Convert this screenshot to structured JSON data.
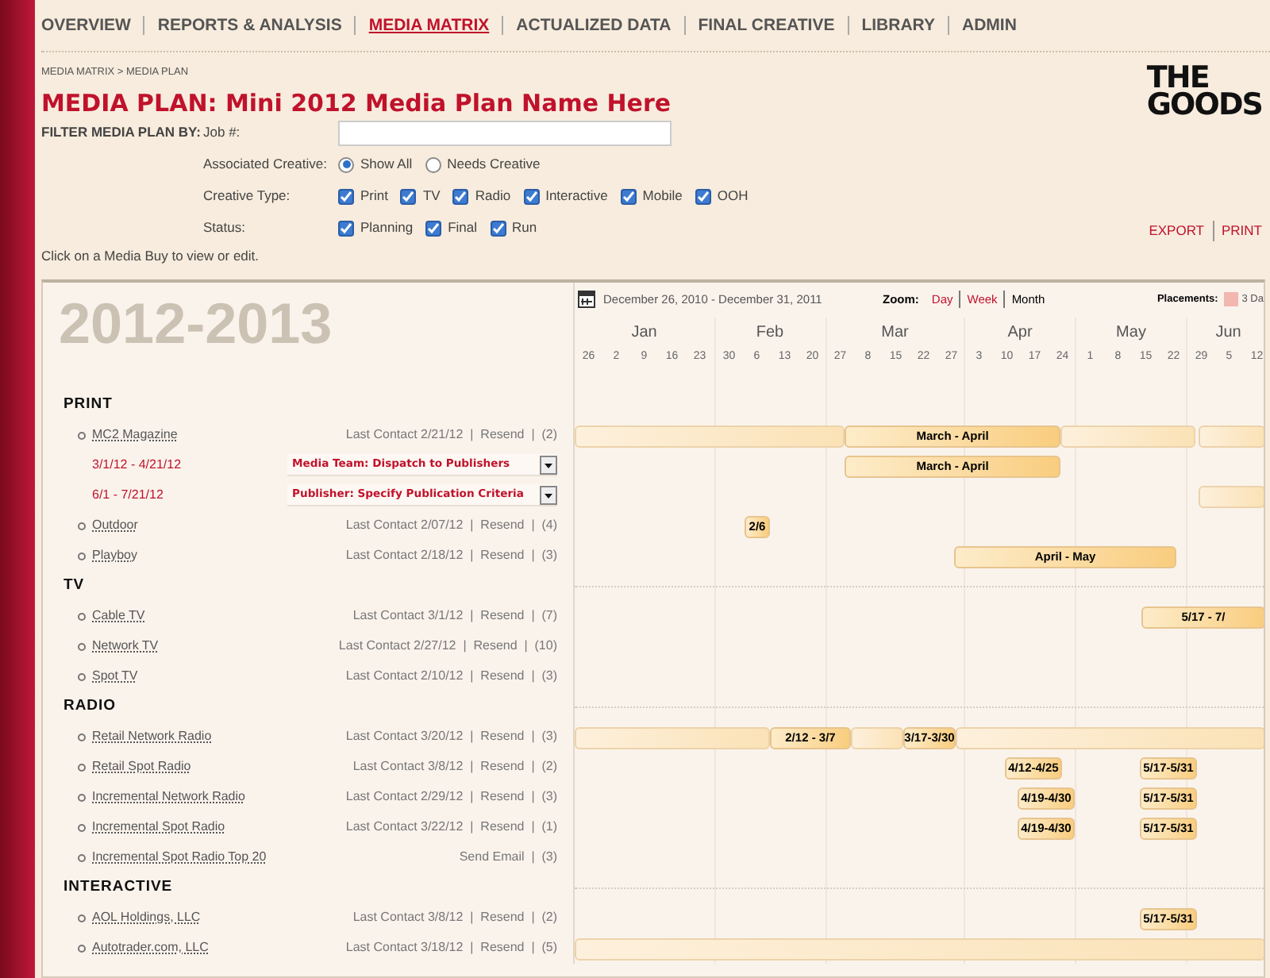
{
  "nav": [
    {
      "label": "OVERVIEW",
      "selected": false
    },
    {
      "label": "REPORTS & ANALYSIS",
      "selected": false
    },
    {
      "label": "MEDIA MATRIX",
      "selected": true
    },
    {
      "label": "ACTUALIZED DATA",
      "selected": false
    },
    {
      "label": "FINAL CREATIVE",
      "selected": false
    },
    {
      "label": "LIBRARY",
      "selected": false
    },
    {
      "label": "ADMIN",
      "selected": false
    }
  ],
  "breadcrumb": "MEDIA MATRIX > MEDIA PLAN",
  "title": "MEDIA PLAN: Mini 2012 Media Plan Name Here",
  "logo": [
    "THE",
    "GOODS"
  ],
  "filter": {
    "heading": "FILTER MEDIA PLAN BY:",
    "job": {
      "label": "Job #:"
    },
    "associated": {
      "label": "Associated Creative:",
      "options": [
        {
          "label": "Show All",
          "selected": true
        },
        {
          "label": "Needs Creative",
          "selected": false
        }
      ]
    },
    "creative_type": {
      "label": "Creative Type:",
      "options": [
        {
          "label": "Print",
          "checked": true
        },
        {
          "label": "TV",
          "checked": true
        },
        {
          "label": "Radio",
          "checked": true
        },
        {
          "label": "Interactive",
          "checked": true
        },
        {
          "label": "Mobile",
          "checked": true
        },
        {
          "label": "OOH",
          "checked": true
        }
      ]
    },
    "status": {
      "label": "Status:",
      "options": [
        {
          "label": "Planning",
          "checked": true
        },
        {
          "label": "Final",
          "checked": true
        },
        {
          "label": "Run",
          "checked": true
        }
      ]
    }
  },
  "actions": [
    "EXPORT",
    "PRINT"
  ],
  "hint": "Click on a Media Buy to view or edit.",
  "panel": {
    "year": "2012-2013",
    "date_range": "December 26, 2010 - December 31, 2011",
    "zoom": {
      "label": "Zoom:",
      "options": [
        {
          "label": "Day",
          "selected": false
        },
        {
          "label": "Week",
          "selected": false
        },
        {
          "label": "Month",
          "selected": true
        }
      ]
    },
    "placements": {
      "label": "Placements:",
      "legend": "3 Da",
      "color": "#f2b8b0"
    },
    "months": [
      {
        "name": "Jan",
        "weeks": [
          "26",
          "2",
          "9",
          "16",
          "23"
        ]
      },
      {
        "name": "Feb",
        "weeks": [
          "30",
          "6",
          "13",
          "20"
        ]
      },
      {
        "name": "Mar",
        "weeks": [
          "27",
          "8",
          "15",
          "22",
          "27"
        ]
      },
      {
        "name": "Apr",
        "weeks": [
          "3",
          "10",
          "17",
          "24"
        ]
      },
      {
        "name": "May",
        "weeks": [
          "1",
          "8",
          "15",
          "22"
        ]
      },
      {
        "name": "Jun",
        "weeks": [
          "29",
          "5",
          "12"
        ]
      }
    ],
    "sections": [
      {
        "title": "PRINT",
        "items": [
          {
            "kind": "media",
            "name": "MC2 Magazine",
            "meta": "Last Contact 2/21/12  |  Resend  |  (2)",
            "bars": [
              {
                "kind": "base"
              },
              {
                "kind": "segment",
                "label": "March - April"
              },
              {
                "kind": "base"
              },
              {
                "kind": "base"
              }
            ]
          },
          {
            "kind": "flight",
            "dates": "3/1/12 - 4/21/12",
            "status": "Media Team: Dispatch to Publishers",
            "bars": [
              {
                "kind": "segment",
                "label": "March - April"
              }
            ]
          },
          {
            "kind": "flight",
            "dates": "6/1 - 7/21/12",
            "status": "Publisher: Specify Publication Criteria",
            "bars": [
              {
                "kind": "base"
              }
            ]
          },
          {
            "kind": "media",
            "name": "Outdoor",
            "meta": "Last Contact 2/07/12  |  Resend  |  (4)",
            "bars": [
              {
                "kind": "segment",
                "label": "2/6"
              }
            ]
          },
          {
            "kind": "media",
            "name": "Playboy",
            "meta": "Last Contact 2/18/12  |  Resend  |  (3)",
            "bars": [
              {
                "kind": "segment",
                "label": "April - May"
              }
            ]
          }
        ]
      },
      {
        "title": "TV",
        "items": [
          {
            "kind": "media",
            "name": "Cable TV",
            "meta": "Last Contact 3/1/12  |  Resend  |  (7)",
            "bars": [
              {
                "kind": "segment",
                "label": "5/17 - 7/"
              }
            ]
          },
          {
            "kind": "media",
            "name": "Network TV",
            "meta": "Last Contact 2/27/12  |  Resend  |  (10)"
          },
          {
            "kind": "media",
            "name": "Spot TV",
            "meta": "Last Contact 2/10/12  |  Resend  |  (3)"
          }
        ]
      },
      {
        "title": "RADIO",
        "items": [
          {
            "kind": "media",
            "name": "Retail Network Radio",
            "meta": "Last Contact 3/20/12  |  Resend  |  (3)",
            "bars": [
              {
                "kind": "base"
              },
              {
                "kind": "segment",
                "label": "2/12 - 3/7"
              },
              {
                "kind": "base"
              },
              {
                "kind": "segment",
                "label": "3/17-3/30"
              },
              {
                "kind": "base"
              }
            ]
          },
          {
            "kind": "media",
            "name": "Retail Spot Radio",
            "meta": "Last Contact 3/8/12  |  Resend  |  (2)",
            "bars": [
              {
                "kind": "segment",
                "label": "4/12-4/25"
              },
              {
                "kind": "segment",
                "label": "5/17-5/31"
              }
            ]
          },
          {
            "kind": "media",
            "name": "Incremental Network Radio",
            "meta": "Last Contact 2/29/12  |  Resend  |  (3)",
            "bars": [
              {
                "kind": "segment",
                "label": "4/19-4/30"
              },
              {
                "kind": "segment",
                "label": "5/17-5/31"
              }
            ]
          },
          {
            "kind": "media",
            "name": "Incremental Spot Radio",
            "meta": "Last Contact 3/22/12  |  Resend  |  (1)",
            "bars": [
              {
                "kind": "segment",
                "label": "4/19-4/30"
              },
              {
                "kind": "segment",
                "label": "5/17-5/31"
              }
            ]
          },
          {
            "kind": "media",
            "name": "Incremental Spot Radio Top 20",
            "meta": "Send Email  |  (3)"
          }
        ]
      },
      {
        "title": "INTERACTIVE",
        "items": [
          {
            "kind": "media",
            "name": "AOL Holdings, LLC",
            "meta": "Last Contact 3/8/12  |  Resend  |  (2)",
            "bars": [
              {
                "kind": "segment",
                "label": "5/17-5/31"
              }
            ]
          },
          {
            "kind": "media",
            "name": "Autotrader.com, LLC",
            "meta": "Last Contact 3/18/12  |  Resend  |  (5)",
            "bars": [
              {
                "kind": "base"
              }
            ]
          }
        ]
      }
    ]
  }
}
